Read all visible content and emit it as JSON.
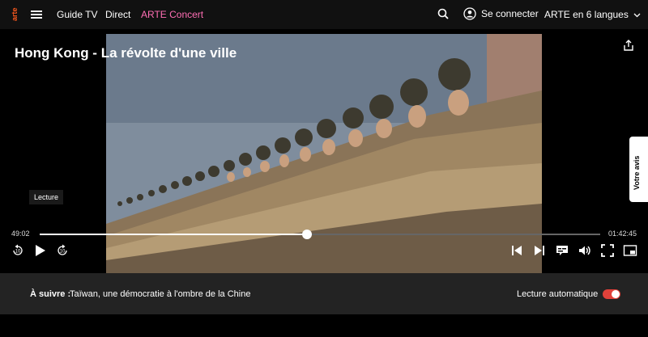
{
  "brand": {
    "logo_name": "arte-logo",
    "logo_text": "arte",
    "accent": "#fd5a1e"
  },
  "nav": {
    "links": [
      "Guide TV",
      "Direct",
      "ARTE Concert"
    ],
    "concert_color": "#ff6eb4",
    "login_label": "Se connecter",
    "language_label": "ARTE en 6 langues"
  },
  "player": {
    "title": "Hong Kong - La révolte d'une ville",
    "tooltip": "Lecture",
    "feedback_label": "Votre avis",
    "elapsed": "49:02",
    "duration": "01:42:45",
    "progress": 0.477,
    "rewind_label": "10",
    "forward_label": "10"
  },
  "next": {
    "label": "À suivre :",
    "title": "Taïwan, une démocratie à l'ombre de la Chine",
    "autoplay_label": "Lecture automatique",
    "autoplay_on": true,
    "toggle_color": "#e0413a"
  }
}
